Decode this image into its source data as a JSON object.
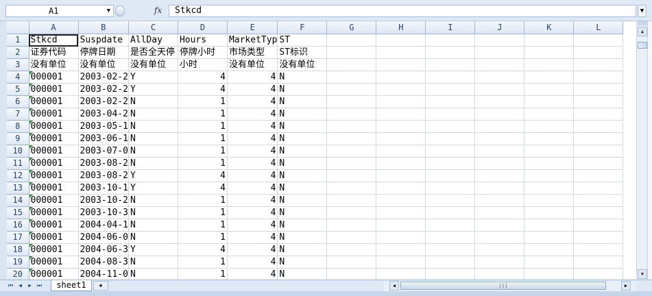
{
  "formula_bar": {
    "name_box": "A1",
    "fx_label": "fx",
    "formula": "Stkcd"
  },
  "columns": [
    "A",
    "B",
    "C",
    "D",
    "E",
    "F",
    "G",
    "H",
    "I",
    "J",
    "K",
    "L"
  ],
  "rows": [
    {
      "n": "1",
      "a": "Stkcd",
      "b": "Suspdate",
      "c": "AllDay",
      "d": "Hours",
      "e": "MarketTyp",
      "f": "ST"
    },
    {
      "n": "2",
      "a": "证券代码",
      "b": "停牌日期",
      "c": "是否全天停",
      "d": "停牌小时",
      "e": "市场类型",
      "f": "ST标识"
    },
    {
      "n": "3",
      "a": "没有单位",
      "b": "没有单位",
      "c": "没有单位",
      "d": "小时",
      "e": "没有单位",
      "f": "没有单位"
    },
    {
      "n": "4",
      "a": "000001",
      "b": "2003-02-2",
      "c": "Y",
      "d": "4",
      "e": "4",
      "f": "N"
    },
    {
      "n": "5",
      "a": "000001",
      "b": "2003-02-2",
      "c": "Y",
      "d": "4",
      "e": "4",
      "f": "N"
    },
    {
      "n": "6",
      "a": "000001",
      "b": "2003-02-2",
      "c": "N",
      "d": "1",
      "e": "4",
      "f": "N"
    },
    {
      "n": "7",
      "a": "000001",
      "b": "2003-04-2",
      "c": "N",
      "d": "1",
      "e": "4",
      "f": "N"
    },
    {
      "n": "8",
      "a": "000001",
      "b": "2003-05-1",
      "c": "N",
      "d": "1",
      "e": "4",
      "f": "N"
    },
    {
      "n": "9",
      "a": "000001",
      "b": "2003-06-1",
      "c": "N",
      "d": "1",
      "e": "4",
      "f": "N"
    },
    {
      "n": "10",
      "a": "000001",
      "b": "2003-07-0",
      "c": "N",
      "d": "1",
      "e": "4",
      "f": "N"
    },
    {
      "n": "11",
      "a": "000001",
      "b": "2003-08-2",
      "c": "N",
      "d": "1",
      "e": "4",
      "f": "N"
    },
    {
      "n": "12",
      "a": "000001",
      "b": "2003-08-2",
      "c": "Y",
      "d": "4",
      "e": "4",
      "f": "N"
    },
    {
      "n": "13",
      "a": "000001",
      "b": "2003-10-1",
      "c": "Y",
      "d": "4",
      "e": "4",
      "f": "N"
    },
    {
      "n": "14",
      "a": "000001",
      "b": "2003-10-2",
      "c": "N",
      "d": "1",
      "e": "4",
      "f": "N"
    },
    {
      "n": "15",
      "a": "000001",
      "b": "2003-10-3",
      "c": "N",
      "d": "1",
      "e": "4",
      "f": "N"
    },
    {
      "n": "16",
      "a": "000001",
      "b": "2004-04-1",
      "c": "N",
      "d": "1",
      "e": "4",
      "f": "N"
    },
    {
      "n": "17",
      "a": "000001",
      "b": "2004-06-0",
      "c": "N",
      "d": "1",
      "e": "4",
      "f": "N"
    },
    {
      "n": "18",
      "a": "000001",
      "b": "2004-06-3",
      "c": "Y",
      "d": "4",
      "e": "4",
      "f": "N"
    },
    {
      "n": "19",
      "a": "000001",
      "b": "2004-08-3",
      "c": "N",
      "d": "1",
      "e": "4",
      "f": "N"
    },
    {
      "n": "20",
      "a": "000001",
      "b": "2004-11-0",
      "c": "N",
      "d": "1",
      "e": "4",
      "f": "N"
    }
  ],
  "tabs": {
    "sheet1": "sheet1",
    "nav": [
      "⏮",
      "◀",
      "▶",
      "⏭"
    ]
  }
}
